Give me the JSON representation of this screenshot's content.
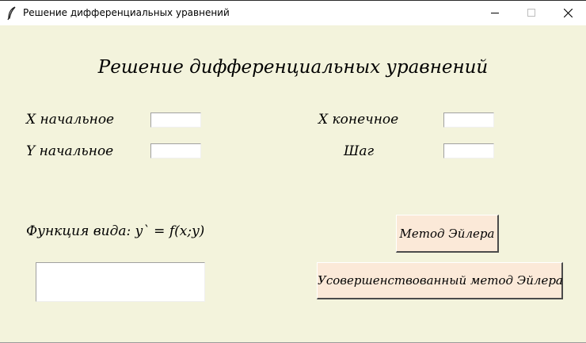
{
  "window": {
    "title": "Решение дифференциальных уравнений",
    "icon": "feather-icon",
    "controls": [
      "minimize-icon",
      "maximize-icon",
      "close-icon"
    ]
  },
  "main": {
    "heading": "Решение дифференциальных уравнений",
    "x_start_label": "X начальное",
    "x_start_value": "",
    "y_start_label": "Y начальное",
    "y_start_value": "",
    "x_end_label": "X конечное",
    "x_end_value": "",
    "step_label": "Шаг",
    "step_value": "",
    "function_label": "Функция вида: y` = f(x;y)",
    "function_value": "",
    "euler_button": "Метод Эйлера",
    "improved_euler_button": "Усовершенствованный метод Эйлера"
  },
  "colors": {
    "background": "#f3f3dc",
    "button_face": "#fbe9d8",
    "entry_bg": "#ffffff"
  }
}
